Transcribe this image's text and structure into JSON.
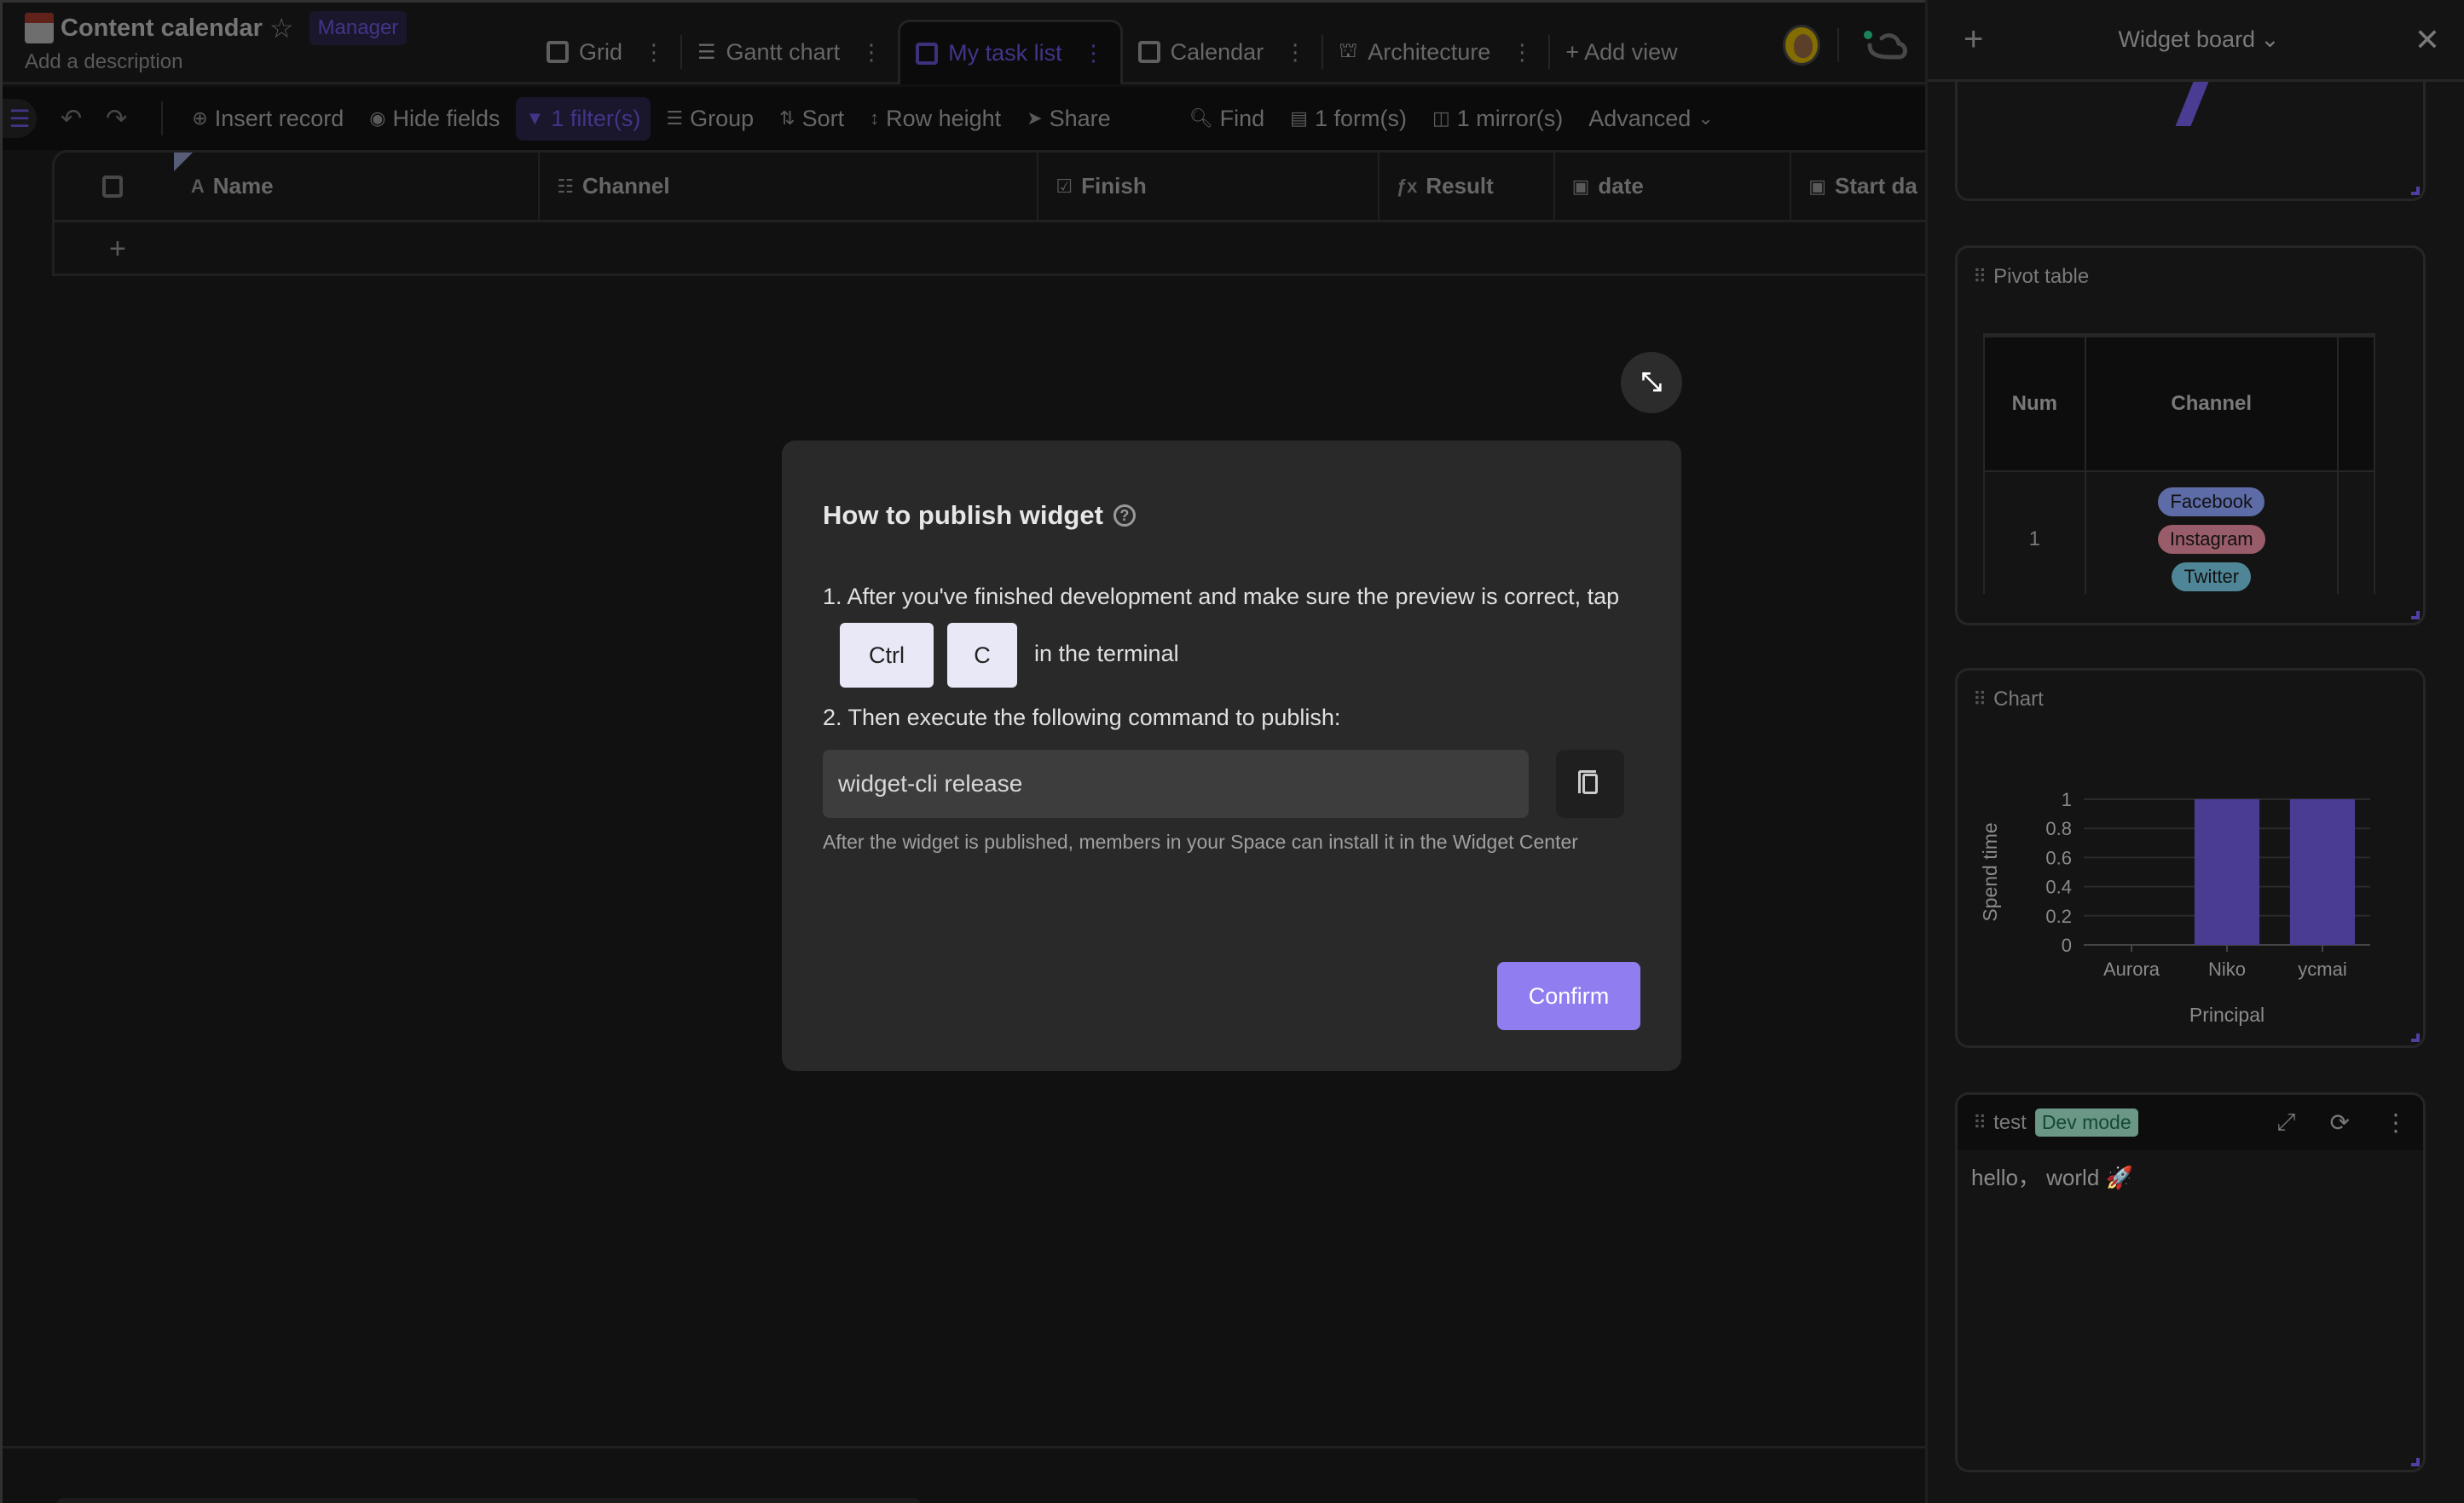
{
  "header": {
    "title": "Content calendar",
    "role_badge": "Manager",
    "description": "Add a description"
  },
  "tabs": [
    {
      "label": "Grid",
      "icon": "grid-icon",
      "active": false
    },
    {
      "label": "Gantt chart",
      "icon": "gantt-icon",
      "active": false
    },
    {
      "label": "My task list",
      "icon": "grid-icon",
      "active": true
    },
    {
      "label": "Calendar",
      "icon": "calendar-icon",
      "active": false
    },
    {
      "label": "Architecture",
      "icon": "architecture-icon",
      "active": false
    }
  ],
  "add_view_label": "+ Add view",
  "toolbar": {
    "insert_record": "Insert record",
    "hide_fields": "Hide fields",
    "filter": "1 filter(s)",
    "group": "Group",
    "sort": "Sort",
    "row_height": "Row height",
    "share": "Share",
    "find": "Find",
    "forms": "1 form(s)",
    "mirrors": "1 mirror(s)",
    "advanced": "Advanced"
  },
  "grid": {
    "columns": [
      {
        "label": "Name",
        "icon": "A"
      },
      {
        "label": "Channel",
        "icon": "☷"
      },
      {
        "label": "Finish",
        "icon": "☑"
      },
      {
        "label": "Result",
        "icon": "ƒx"
      },
      {
        "label": "date",
        "icon": "▣"
      },
      {
        "label": "Start da",
        "icon": "▣"
      }
    ],
    "add_row": "+"
  },
  "modal": {
    "title": "How to publish widget",
    "step1_prefix": "1. After you've finished development and make sure the preview is correct, tap",
    "key1": "Ctrl",
    "key2": "C",
    "step1_suffix": "in the terminal",
    "step2": "2. Then execute the following command to publish:",
    "command": "widget-cli release",
    "hint": "After the widget is published, members in your Space can install it in the Widget Center",
    "confirm": "Confirm"
  },
  "panel": {
    "title": "Widget board",
    "widgets": {
      "pivot": {
        "title": "Pivot table",
        "headers": [
          "Num",
          "Channel"
        ],
        "rows": [
          {
            "num": "1",
            "channels": [
              {
                "label": "Facebook",
                "color": "#6a7bc0"
              },
              {
                "label": "Instagram",
                "color": "#b06a78"
              },
              {
                "label": "Twitter",
                "color": "#5a9aae"
              }
            ]
          }
        ]
      },
      "chart": {
        "title": "Chart"
      },
      "test": {
        "title": "test",
        "badge": "Dev mode",
        "content": "hello， world 🚀"
      }
    }
  },
  "colors": {
    "accent": "#907ef0",
    "bar": "#4a3b93"
  },
  "chart_data": {
    "type": "bar",
    "title": "Chart",
    "categories": [
      "Aurora",
      "Niko",
      "ycmai"
    ],
    "values": [
      0,
      1,
      1
    ],
    "xlabel": "Principal",
    "ylabel": "Spend time",
    "ylim": [
      0,
      1
    ],
    "yticks": [
      "0",
      "0.2",
      "0.4",
      "0.6",
      "0.8",
      "1"
    ],
    "grid": true
  }
}
